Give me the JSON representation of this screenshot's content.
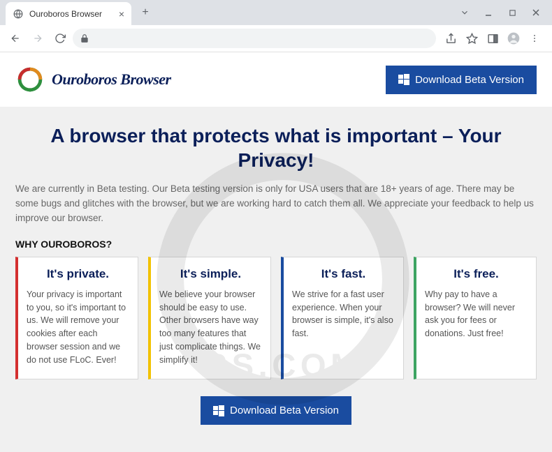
{
  "browser": {
    "tab_title": "Ouroboros Browser",
    "url": ""
  },
  "header": {
    "brand_name": "Ouroboros Browser",
    "download_label": "Download Beta Version"
  },
  "hero": {
    "title": "A browser that protects what is important – Your Privacy!",
    "body": "We are currently in Beta testing. Our Beta testing version is only for USA users that are 18+ years of age. There may be some bugs and glitches with the browser, but we are working hard to catch them all. We appreciate your feedback to help us improve our browser."
  },
  "section_label": "WHY OUROBOROS?",
  "cards": [
    {
      "title": "It's private.",
      "body": "Your privacy is important to you, so it's important to us. We will remove your cookies after each browser session and we do not use FLoC. Ever!"
    },
    {
      "title": "It's simple.",
      "body": "We believe your browser should be easy to use. Other browsers have way too many features that just complicate things. We simplify it!"
    },
    {
      "title": "It's fast.",
      "body": "We strive for a fast user experience. When your browser is simple, it's also fast."
    },
    {
      "title": "It's free.",
      "body": "Why pay to have a browser? We will never ask you for fees or donations. Just free!"
    }
  ],
  "cta": {
    "label": "Download Beta Version"
  },
  "colors": {
    "brand_blue": "#1a4ca0",
    "brand_dark": "#0b1f59",
    "card_red": "#d32f2f",
    "card_yellow": "#f2c200",
    "card_green": "#3da462"
  }
}
